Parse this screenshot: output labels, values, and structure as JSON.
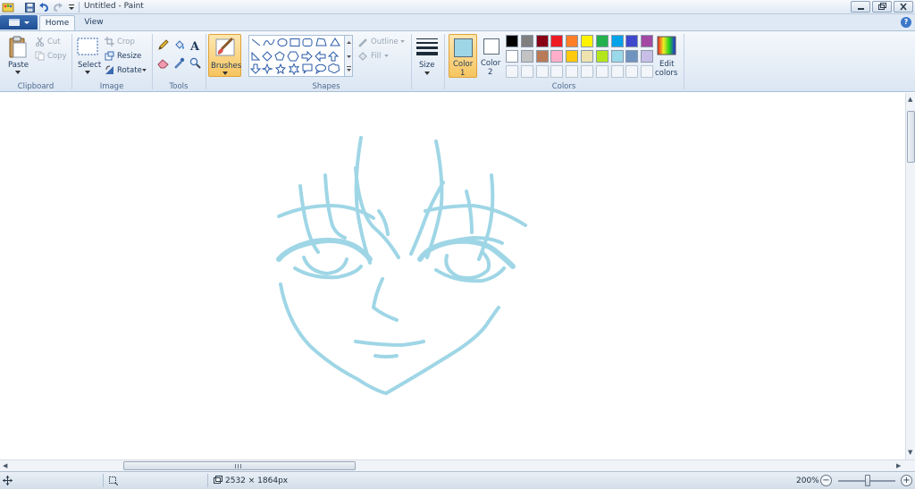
{
  "window": {
    "title": "Untitled - Paint"
  },
  "tabs": [
    {
      "label": "Home",
      "active": true
    },
    {
      "label": "View",
      "active": false
    }
  ],
  "ribbon": {
    "clipboard": {
      "label": "Clipboard",
      "paste": "Paste",
      "cut": "Cut",
      "copy": "Copy"
    },
    "image": {
      "label": "Image",
      "select": "Select",
      "crop": "Crop",
      "resize": "Resize",
      "rotate": "Rotate"
    },
    "tools": {
      "label": "Tools"
    },
    "brushes": {
      "label": "Brushes"
    },
    "shapes": {
      "label": "Shapes",
      "outline": "Outline",
      "fill": "Fill"
    },
    "size": {
      "label": "Size"
    },
    "colors": {
      "label": "Colors",
      "color1_label": "Color",
      "color1_num": "1",
      "color2_label": "Color",
      "color2_num": "2",
      "edit_colors_line1": "Edit",
      "edit_colors_line2": "colors",
      "color1_value": "#9fd6e6",
      "color2_value": "#ffffff",
      "palette_row1": [
        "#000000",
        "#7f7f7f",
        "#880015",
        "#ed1c24",
        "#ff7f27",
        "#fff200",
        "#22b14c",
        "#00a2e8",
        "#3f48cc",
        "#a349a4"
      ],
      "palette_row2": [
        "#ffffff",
        "#c3c3c3",
        "#b97a57",
        "#ffaec9",
        "#ffc90e",
        "#efe4b0",
        "#b5e61d",
        "#99d9ea",
        "#7092be",
        "#c8bfe7"
      ]
    }
  },
  "canvas": {
    "stroke_color": "#9fd6e6"
  },
  "status": {
    "dimensions": "2532 × 1864px",
    "zoom": "200%"
  }
}
